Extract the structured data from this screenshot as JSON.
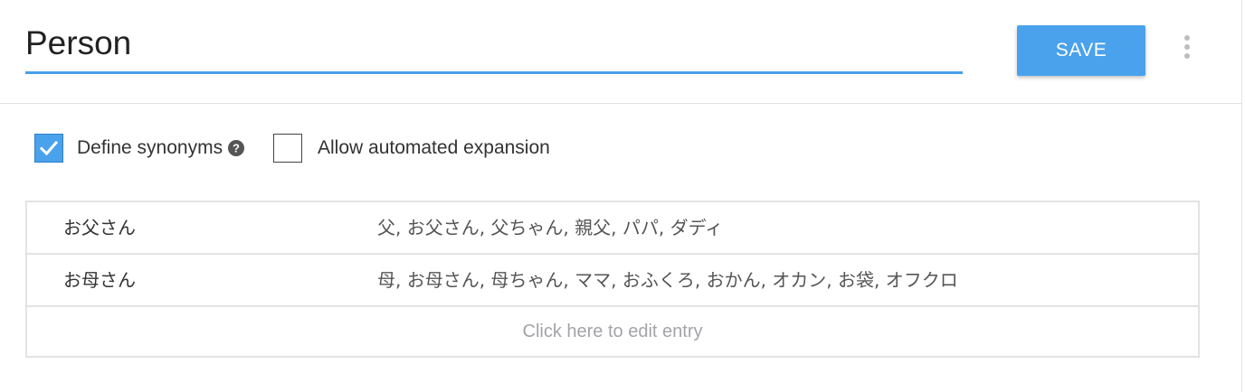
{
  "entity": {
    "name": "Person",
    "save_label": "SAVE",
    "more_menu_icon": "more-vert-icon"
  },
  "options": {
    "define_synonyms": {
      "label": "Define synonyms",
      "checked": true,
      "help_icon": "help-circle-icon"
    },
    "automated_expansion": {
      "label": "Allow automated expansion",
      "checked": false
    }
  },
  "entries": [
    {
      "value": "お父さん",
      "synonyms": "父, お父さん, 父ちゃん, 親父, パパ, ダディ"
    },
    {
      "value": "お母さん",
      "synonyms": "母, お母さん, 母ちゃん, ママ, おふくろ, おかん, オカン, お袋, オフクロ"
    }
  ],
  "add_entry_placeholder": "Click here to edit entry",
  "colors": {
    "accent": "#4aa2ec",
    "underline": "#4a9fe8",
    "border": "#e3e3e3",
    "placeholder": "#a3a3a8"
  }
}
